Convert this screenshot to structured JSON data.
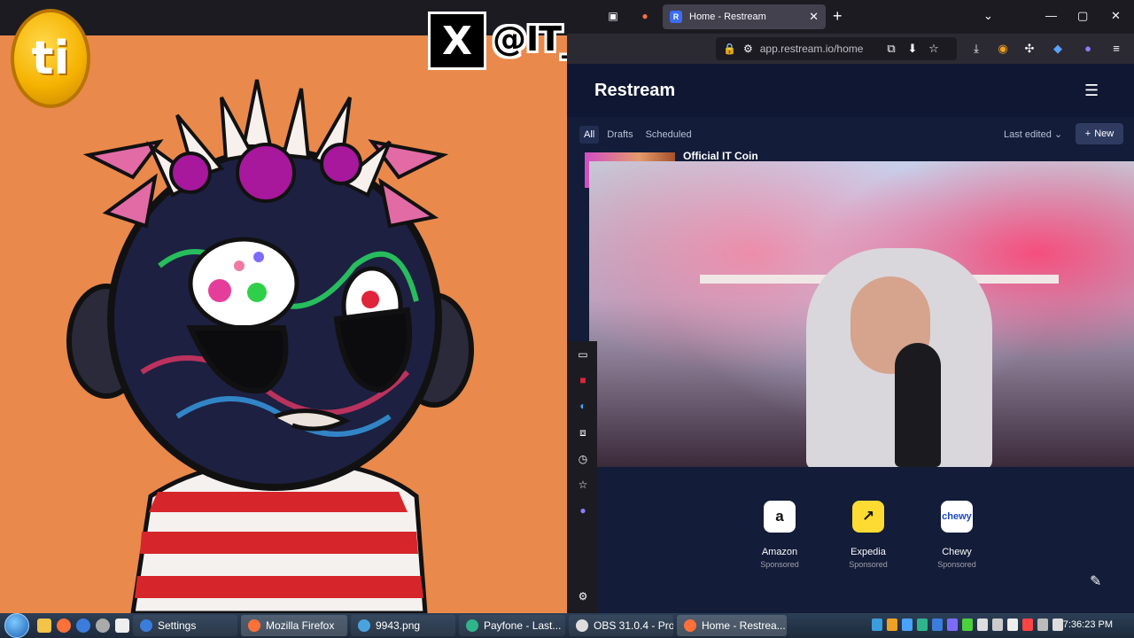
{
  "overlay": {
    "coin_letter": "ti",
    "x_logo": "X",
    "handle": "@IT_KIDS_KOL"
  },
  "browser": {
    "tab_title": "Home - Restream",
    "tab_favicon_letter": "R",
    "url": "app.restream.io/home"
  },
  "restream": {
    "brand": "Restream",
    "filters": [
      "All",
      "Drafts",
      "Scheduled"
    ],
    "sort_label": "Last edited",
    "new_button": "New",
    "card_title": "Official IT Coin"
  },
  "shortcuts": [
    {
      "name": "Amazon",
      "sub": "Sponsored",
      "glyph": "a",
      "bg": "#ffffff",
      "fg": "#111111"
    },
    {
      "name": "Expedia",
      "sub": "Sponsored",
      "glyph": "↗",
      "bg": "#FDDB32",
      "fg": "#111111"
    },
    {
      "name": "Chewy",
      "sub": "Sponsored",
      "glyph": "chewy",
      "bg": "#ffffff",
      "fg": "#1c49c2"
    }
  ],
  "taskbar": {
    "items": [
      {
        "label": "Settings",
        "color": "#3b7ddd"
      },
      {
        "label": "Mozilla Firefox",
        "color": "#ff7139"
      },
      {
        "label": "9943.png",
        "color": "#4aa3df"
      },
      {
        "label": "Payfone - Last...",
        "color": "#2fb58c"
      },
      {
        "label": "OBS 31.0.4 - Pro...",
        "color": "#dddddd"
      },
      {
        "label": "Home - Restrea...",
        "color": "#ff7139"
      }
    ],
    "clock": "7:36:23 PM"
  },
  "colors": {
    "art_bg": "#E9894B",
    "page_bg": "#131c38",
    "accent": "#2f3b61"
  }
}
